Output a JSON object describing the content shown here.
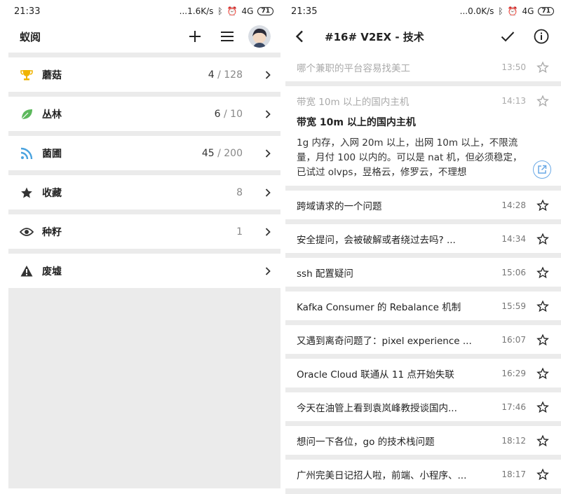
{
  "left": {
    "status_time": "21:33",
    "status_speed": "...1.6K/s",
    "network": "4G",
    "battery": "71",
    "app_title": "蚁阅",
    "nav_items": [
      {
        "label": "蘑菇",
        "unread": "4",
        "total": "/ 128",
        "icon": "trophy-icon",
        "color": "#f0b400"
      },
      {
        "label": "丛林",
        "unread": "6",
        "total": "/ 10",
        "icon": "leaf-icon",
        "color": "#5cb85c"
      },
      {
        "label": "菌圃",
        "unread": "45",
        "total": "/ 200",
        "icon": "rss-icon",
        "color": "#4aa3df"
      },
      {
        "label": "收藏",
        "unread": "",
        "total": "8",
        "icon": "star-icon",
        "color": "#333333"
      },
      {
        "label": "种籽",
        "unread": "",
        "total": "1",
        "icon": "eye-icon",
        "color": "#333333"
      },
      {
        "label": "废墟",
        "unread": "",
        "total": "",
        "icon": "warning-icon",
        "color": "#333333"
      }
    ]
  },
  "right": {
    "status_time": "21:35",
    "status_speed": "...0.0K/s",
    "network": "4G",
    "battery": "71",
    "title": "#16# V2EX - 技术",
    "articles": [
      {
        "title": "哪个兼职的平台容易找美工",
        "time": "13:50"
      },
      {
        "title": "带宽 10m 以上的国内主机",
        "time": "14:13"
      },
      {
        "title": "跨域请求的一个问题",
        "time": "14:28"
      },
      {
        "title": "安全提问，会被破解或者绕过去吗? ...",
        "time": "14:34"
      },
      {
        "title": "ssh 配置疑问",
        "time": "15:06"
      },
      {
        "title": "Kafka Consumer 的 Rebalance 机制",
        "time": "15:59"
      },
      {
        "title": "又遇到离奇问题了：pixel experience ...",
        "time": "16:07"
      },
      {
        "title": "Oracle Cloud 联通从 11 点开始失联",
        "time": "16:29"
      },
      {
        "title": "今天在油管上看到袁岚峰教授谈国内...",
        "time": "17:46"
      },
      {
        "title": "想问一下各位，go 的技术栈问题",
        "time": "18:12"
      },
      {
        "title": "广州完美日记招人啦，前端、小程序、...",
        "time": "18:17"
      }
    ],
    "expanded": {
      "heading": "带宽 10m 以上的国内主机",
      "body": "1g 内存，入网 20m 以上，出网 10m 以上，不限流量，月付 100 以内的。可以是 nat 机，但必须稳定，已试过 olvps，昱格云，修罗云，不理想"
    }
  }
}
